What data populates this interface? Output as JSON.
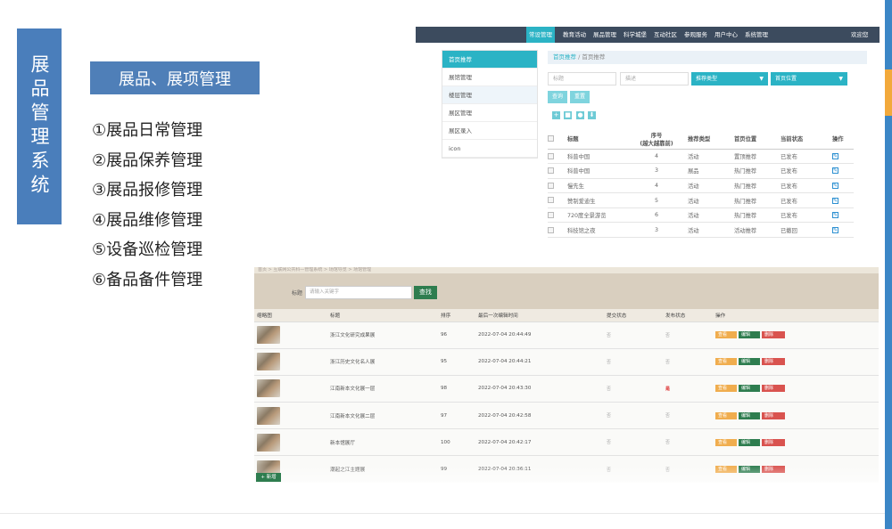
{
  "slide": {
    "vertical_title": "展品管理系统",
    "section_header": "展品、展项管理",
    "items": [
      "①展品日常管理",
      "②展品保养管理",
      "③展品报修管理",
      "④展品维修管理",
      "⑤设备巡检管理",
      "⑥备品备件管理"
    ],
    "colors": {
      "title_bg": "#4a7ebb",
      "header_bg": "#4f7fb8",
      "accent_blue": "#3b86c6",
      "accent_orange": "#f2a93b"
    }
  },
  "shot1": {
    "topnav": [
      "常设管理",
      "教育活动",
      "展品管理",
      "科学城堡",
      "互动社区",
      "参观服务",
      "用户中心",
      "系统管理"
    ],
    "topnav_right": "欢迎您",
    "sidebar": [
      "首页推荐",
      "展馆管理",
      "楼层管理",
      "展区管理",
      "展区录入",
      "icon"
    ],
    "breadcrumb": {
      "home": "首页推荐",
      "sep": "/",
      "current": "首页推荐"
    },
    "filters": {
      "title_placeholder": "标题",
      "desc_placeholder": "描述",
      "type_select": "推荐类型",
      "position_select": "首页位置"
    },
    "buttons": {
      "search": "查询",
      "reset": "重置"
    },
    "tool_icons": [
      "+",
      "■",
      "●",
      "⬇"
    ],
    "columns": [
      "标题",
      "序号",
      "(越大越靠前)",
      "推荐类型",
      "首页位置",
      "当前状态",
      "操作"
    ],
    "rows": [
      {
        "title": "科普中国",
        "order": "4",
        "type": "活动",
        "position": "置顶推荐",
        "status": "已发布"
      },
      {
        "title": "科普中国",
        "order": "3",
        "type": "展品",
        "position": "热门推荐",
        "status": "已发布"
      },
      {
        "title": "慢先生",
        "order": "4",
        "type": "活动",
        "position": "热门推荐",
        "status": "已发布"
      },
      {
        "title": "赞制爱迪生",
        "order": "5",
        "type": "活动",
        "position": "热门推荐",
        "status": "已发布"
      },
      {
        "title": "720度全景游览",
        "order": "6",
        "type": "活动",
        "position": "热门推荐",
        "status": "已发布"
      },
      {
        "title": "科技馆之夜",
        "order": "3",
        "type": "活动",
        "position": "活动推荐",
        "status": "已撤回"
      }
    ]
  },
  "shot2": {
    "breadcrumb": "首页 > 互联网公共科—管理系统 > 场馆导览 > 场馆管理",
    "search_label": "标题",
    "search_placeholder": "请输入关键字",
    "search_button": "查找",
    "columns": [
      "缩略图",
      "标题",
      "排序",
      "最后一次编辑时间",
      "提交状态",
      "发布状态",
      "操作"
    ],
    "actions": {
      "view": "查看",
      "edit": "编辑",
      "delete": "删除"
    },
    "rows": [
      {
        "title": "浙江文化研究成果展",
        "order": "96",
        "time": "2022-07-04 20:44:49",
        "submit": "否",
        "publish": "否"
      },
      {
        "title": "浙江历史文化名人展",
        "order": "95",
        "time": "2022-07-04 20:44:21",
        "submit": "否",
        "publish": "否"
      },
      {
        "title": "江南新本文化展一层",
        "order": "98",
        "time": "2022-07-04 20:43:30",
        "submit": "否",
        "publish": "是"
      },
      {
        "title": "江南新本文化展二层",
        "order": "97",
        "time": "2022-07-04 20:42:58",
        "submit": "否",
        "publish": "否"
      },
      {
        "title": "新本馆展厅",
        "order": "100",
        "time": "2022-07-04 20:42:17",
        "submit": "否",
        "publish": "否"
      },
      {
        "title": "潮起之江主题展",
        "order": "99",
        "time": "2022-07-04 20:36:11",
        "submit": "否",
        "publish": "否"
      }
    ],
    "add_button": "+ 新增"
  }
}
